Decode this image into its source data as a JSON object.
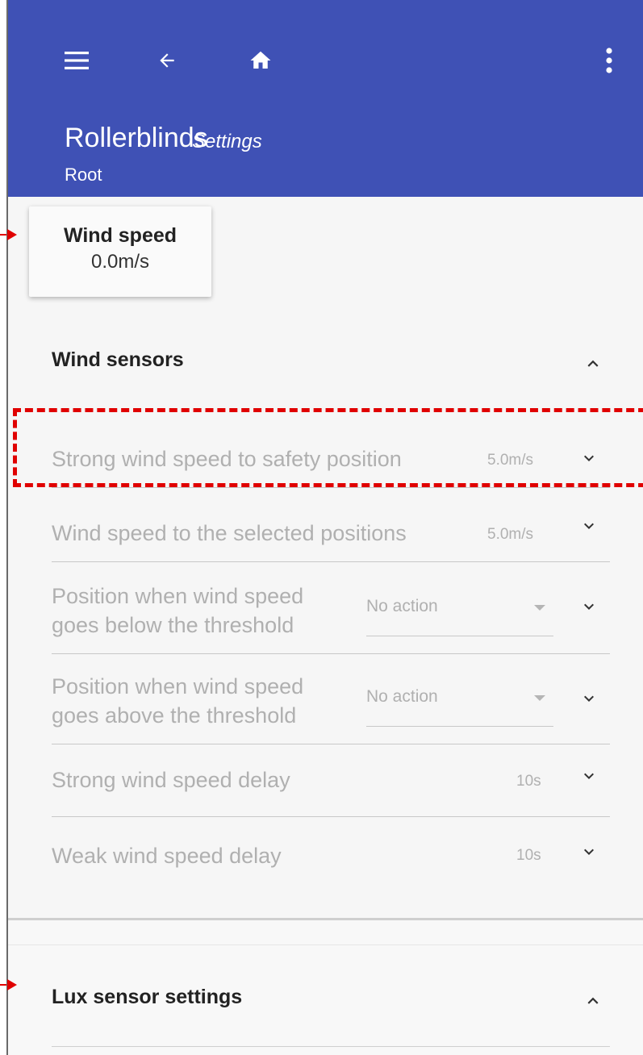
{
  "header": {
    "title": "Rollerblinds",
    "subtitle": "Settings",
    "breadcrumb": "Root",
    "color": "#3f51b5",
    "icons": [
      "menu-icon",
      "back-arrow-icon",
      "home-icon",
      "more-vert-icon"
    ]
  },
  "badge": {
    "label": "Wind speed",
    "value": "0.0m/s"
  },
  "wind_section": {
    "title": "Wind sensors",
    "rows": [
      {
        "label": "Strong wind speed to safety position",
        "value": "5.0m/s"
      },
      {
        "label": "Wind speed to the selected positions",
        "value": "5.0m/s"
      },
      {
        "label_line1": "Position when wind speed",
        "label_line2": "goes below the threshold",
        "select_value": "No action"
      },
      {
        "label_line1": "Position when wind speed",
        "label_line2": "goes above the threshold",
        "select_value": "No action"
      },
      {
        "label": "Strong wind speed delay",
        "value": "10s"
      },
      {
        "label": "Weak wind speed delay",
        "value": "10s"
      }
    ]
  },
  "lux_section": {
    "title": "Lux sensor settings"
  },
  "annotation_color": "#e00000"
}
